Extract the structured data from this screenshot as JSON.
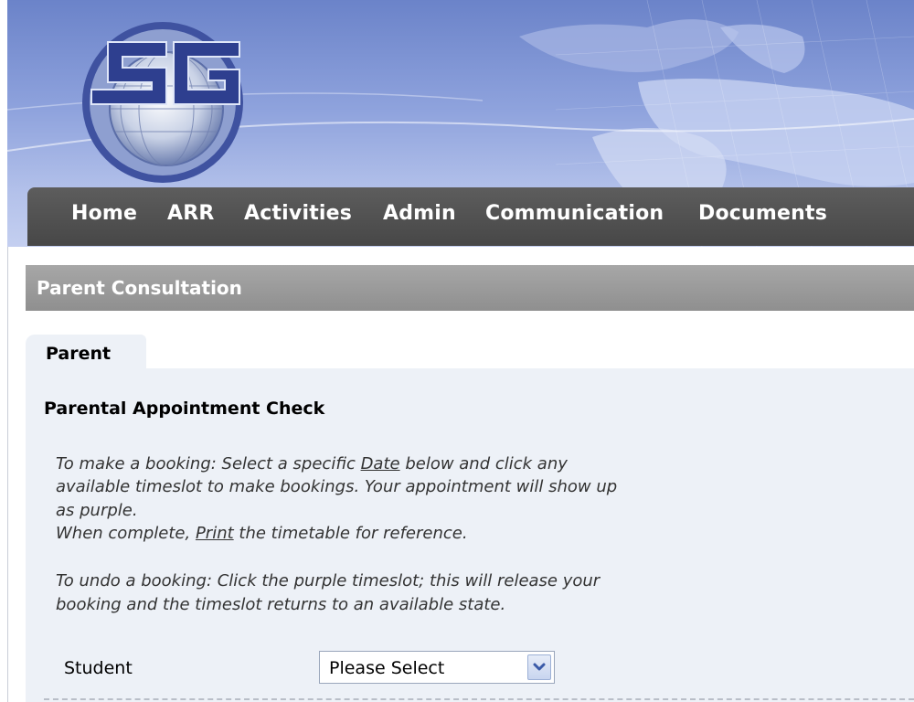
{
  "brand": {
    "logo_name": "SG globe logo",
    "colors": {
      "banner": "#8fa3dd",
      "nav": "#505050",
      "section": "#9a9a9a",
      "panel": "#edf1f7"
    }
  },
  "nav": {
    "items": [
      "Home",
      "ARR",
      "Activities",
      "Admin",
      "Communication",
      "Documents"
    ]
  },
  "section": {
    "title": "Parent Consultation"
  },
  "tabs": [
    {
      "label": "Parent",
      "active": true
    }
  ],
  "panel": {
    "title": "Parental Appointment Check",
    "booking": {
      "line1_pre": "To make a booking: Select a specific ",
      "line1_link": "Date",
      "line1_post": " below and click any",
      "line2": "available timeslot to make bookings. Your appointment will show up",
      "line3": "as purple.",
      "line4_pre": "When complete, ",
      "line4_link": "Print",
      "line4_post": " the timetable for reference."
    },
    "undo": {
      "line1": "To undo a booking: Click the purple timeslot; this will release your",
      "line2": "booking and the timeslot returns to an available state."
    },
    "student": {
      "label": "Student",
      "selected": "Please Select"
    }
  }
}
